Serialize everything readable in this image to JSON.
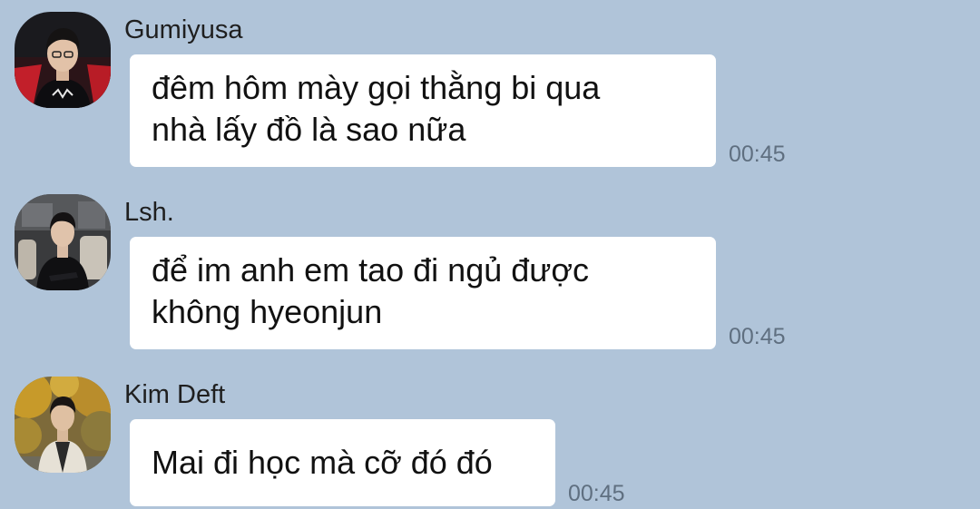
{
  "messages": [
    {
      "sender": "Gumiyusa",
      "lines": [
        "đêm hôm mày gọi thằng bi qua",
        "nhà lấy đồ là sao nữa"
      ],
      "time": "00:45"
    },
    {
      "sender": "Lsh.",
      "lines": [
        "để im anh em tao đi ngủ được",
        "không hyeonjun"
      ],
      "time": "00:45"
    },
    {
      "sender": "Kim Deft",
      "lines": [
        "Mai đi học mà cỡ đó đó"
      ],
      "time": "00:45"
    }
  ],
  "colors": {
    "background": "#b0c4d9",
    "bubble": "#ffffff",
    "timestamp": "#5f6f80"
  }
}
